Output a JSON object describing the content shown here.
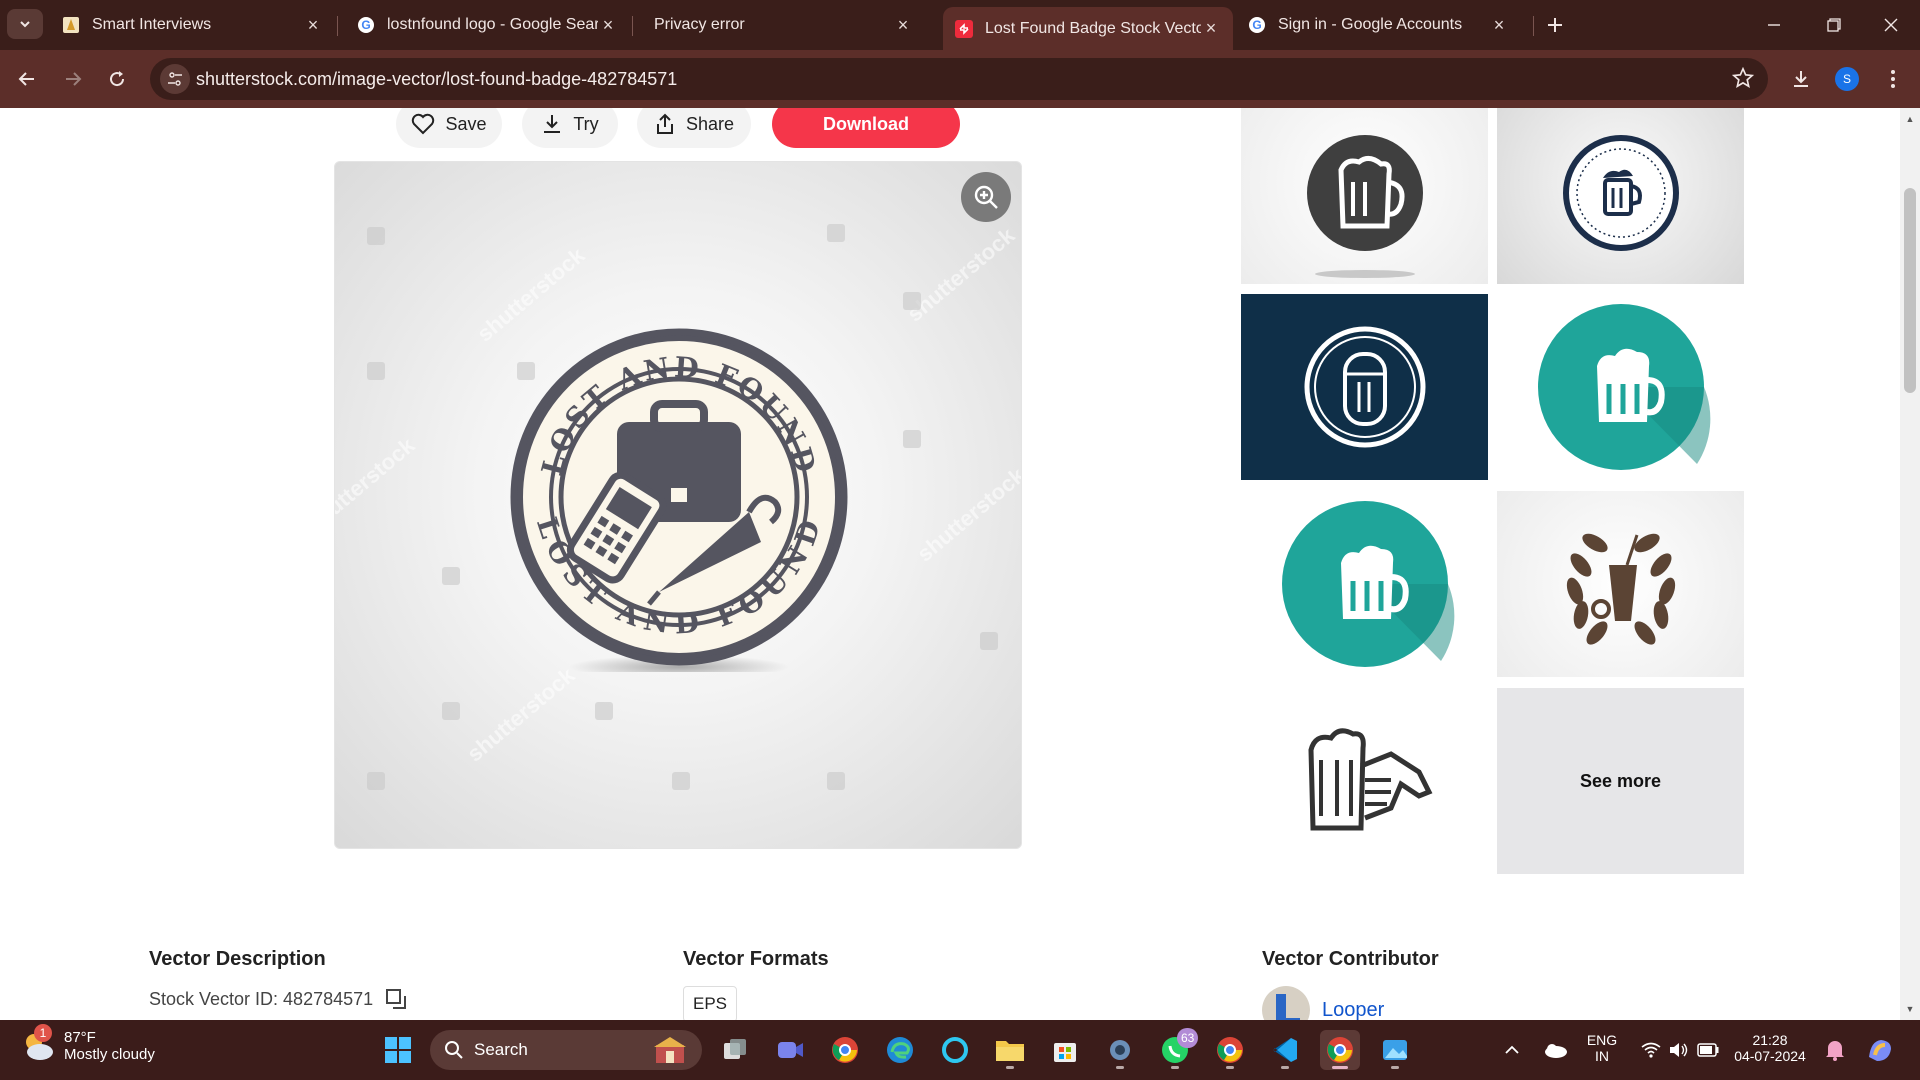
{
  "browser": {
    "tabs": [
      {
        "title": "Smart Interviews",
        "active": false
      },
      {
        "title": "lostnfound logo - Google Search",
        "active": false
      },
      {
        "title": "Privacy error",
        "active": false
      },
      {
        "title": "Lost Found Badge Stock Vector",
        "active": true
      },
      {
        "title": "Sign in - Google Accounts",
        "active": false
      }
    ],
    "url": "shutterstock.com/image-vector/lost-found-badge-482784571",
    "profile_initial": "S"
  },
  "actions": {
    "save": "Save",
    "try": "Try",
    "share": "Share",
    "download": "Download"
  },
  "badge": {
    "top_text": "LOST AND FOUND",
    "bottom_text": "LOST AND FOUND",
    "watermark": "shutterstock",
    "watermark_small": "Looper"
  },
  "related": {
    "see_more": "See more"
  },
  "sections": {
    "description_title": "Vector Description",
    "stock_id": "Stock Vector ID: 482784571",
    "formats_title": "Vector Formats",
    "format": "EPS",
    "contributor_title": "Vector Contributor",
    "contributor_name": "Looper"
  },
  "taskbar": {
    "weather_temp": "87°F",
    "weather_cond": "Mostly cloudy",
    "weather_badge": "1",
    "search": "Search",
    "whatsapp_badge": "63",
    "lang_top": "ENG",
    "lang_bottom": "IN",
    "time": "21:28",
    "date": "04-07-2024"
  },
  "colors": {
    "accent": "#f5364a",
    "tab_strip": "#3a1e1a",
    "toolbar": "#5c2e29",
    "teal": "#1fa59a",
    "navy": "#0f2f48",
    "badge_gray": "#555560"
  }
}
